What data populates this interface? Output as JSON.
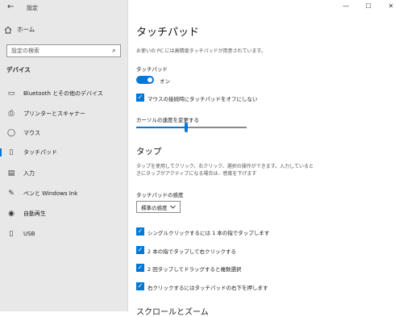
{
  "window": {
    "title": "設定",
    "back_icon": "←",
    "controls": {
      "minimize": "—",
      "maximize": "☐",
      "close": "✕"
    }
  },
  "sidebar": {
    "home_label": "ホーム",
    "search_placeholder": "設定の検索",
    "section_label": "デバイス",
    "items": [
      {
        "label": "Bluetooth とその他のデバイス",
        "icon": "bluetooth-icon",
        "glyph": "▭"
      },
      {
        "label": "プリンターとスキャナー",
        "icon": "printer-icon",
        "glyph": "⎙"
      },
      {
        "label": "マウス",
        "icon": "mouse-icon",
        "glyph": "◯"
      },
      {
        "label": "タッチパッド",
        "icon": "touchpad-icon",
        "glyph": "▯",
        "active": true
      },
      {
        "label": "入力",
        "icon": "keyboard-icon",
        "glyph": "▤"
      },
      {
        "label": "ペンと Windows Ink",
        "icon": "pen-icon",
        "glyph": "✎"
      },
      {
        "label": "自動再生",
        "icon": "autoplay-icon",
        "glyph": "◉"
      },
      {
        "label": "USB",
        "icon": "usb-icon",
        "glyph": "▯"
      }
    ]
  },
  "main": {
    "title": "タッチパッド",
    "description": "お使いの PC には高精度タッチパッドが用意されています。",
    "touchpad": {
      "label": "タッチパッド",
      "toggle_text": "オン",
      "toggle_on": true,
      "disable_with_mouse_label": "マウスの接続時にタッチパッドをオフにしない",
      "disable_with_mouse_checked": true
    },
    "cursor_speed": {
      "label": "カーソルの速度を変更する",
      "value_fraction": 0.45
    },
    "tap": {
      "title": "タップ",
      "description": "タップを使用してクリック、右クリック、選択の操作ができます。入力しているときにタップがアクティブになる場合は、感度を下げます",
      "sensitivity_label": "タッチパッドの感度",
      "sensitivity_value": "標準の感度",
      "options": [
        {
          "label": "シングルクリックするには 1 本の指でタップします",
          "checked": true
        },
        {
          "label": "2 本の指でタップして右クリックする",
          "checked": true
        },
        {
          "label": "2 回タップしてドラッグすると複数選択",
          "checked": true
        },
        {
          "label": "右クリックするにはタッチパッドの右下を押します",
          "checked": true
        }
      ]
    },
    "next_section_title": "スクロールとズーム"
  },
  "colors": {
    "accent": "#0078d7",
    "sidebar_bg": "#e8e8e8"
  }
}
